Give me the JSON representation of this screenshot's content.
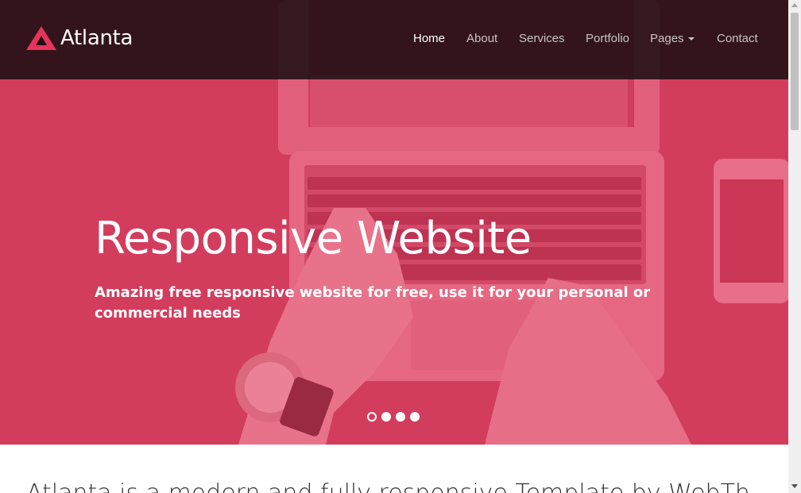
{
  "brand": {
    "name": "Atlanta",
    "icon": "triangle-logo-icon",
    "accent": "#e8345c"
  },
  "nav": {
    "items": [
      {
        "label": "Home",
        "active": true
      },
      {
        "label": "About",
        "active": false
      },
      {
        "label": "Services",
        "active": false
      },
      {
        "label": "Portfolio",
        "active": false
      },
      {
        "label": "Pages",
        "active": false,
        "has_dropdown": true
      },
      {
        "label": "Contact",
        "active": false
      }
    ]
  },
  "hero": {
    "title": "Responsive Website",
    "subtitle": "Amazing free responsive website for free, use it for your personal or commercial needs",
    "slide_count": 4,
    "active_slide": 1,
    "overlay_color": "#e23a62"
  },
  "intro": {
    "text": "Atlanta is a modern and fully responsive Template by WebTh"
  }
}
